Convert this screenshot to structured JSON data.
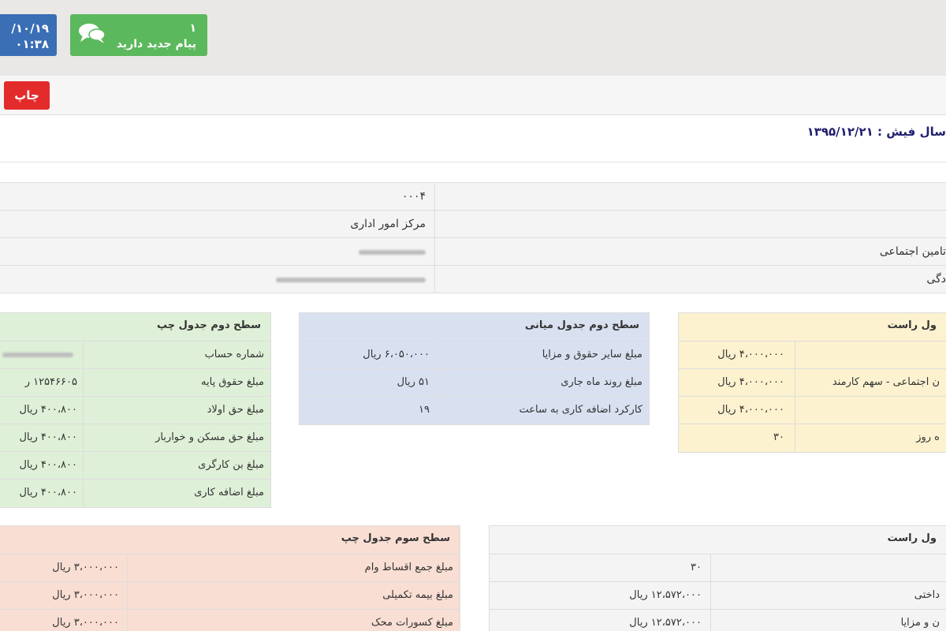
{
  "header": {
    "date": "/۱۰/۱۹",
    "time": "۰۱:۳۸",
    "messages": {
      "count": "۱",
      "text": "پیام جدید دارید",
      "icon": "chat-bubbles-icon"
    },
    "colors": {
      "date_box": "#3a6eb5",
      "message_box": "#5cb85c",
      "print_button": "#e32b2b"
    }
  },
  "toolbar": {
    "print_label": "چاپ"
  },
  "issue": {
    "label": "سال فیش :",
    "date": "۱۳۹۵/۱۲/۲۱"
  },
  "info": {
    "rows": [
      {
        "label": "",
        "value": "۰۰۰۴"
      },
      {
        "label": "",
        "value": "مرکز امور اداری"
      },
      {
        "label": "تامین اجتماعی",
        "value": ""
      },
      {
        "label": "دگی",
        "value": ""
      }
    ]
  },
  "panels": {
    "green": {
      "title": "سطح دوم جدول چپ",
      "rows": [
        {
          "label": "شماره حساب",
          "value": ""
        },
        {
          "label": "مبلغ حقوق پایه",
          "value": "۱۲۵۴۶۶۰۵ ر"
        },
        {
          "label": "مبلغ حق اولاد",
          "value": "۴۰۰،۸۰۰ ریال"
        },
        {
          "label": "مبلغ حق مسکن و خواربار",
          "value": "۴۰۰،۸۰۰ ریال"
        },
        {
          "label": "مبلغ بن کارگری",
          "value": "۴۰۰،۸۰۰ ریال"
        },
        {
          "label": "مبلغ اضافه کاری",
          "value": "۴۰۰،۸۰۰ ریال"
        }
      ]
    },
    "blue": {
      "title": "سطح دوم جدول میانی",
      "rows": [
        {
          "label": "مبلغ سایر حقوق و مزایا",
          "value": "۶،۰۵۰،۰۰۰ ریال"
        },
        {
          "label": "مبلغ روند ماه جاری",
          "value": "۵۱ ریال"
        },
        {
          "label": "کارکرد اضافه کاری به ساعت",
          "value": "۱۹"
        }
      ]
    },
    "yellow": {
      "title": "ول راست",
      "rows": [
        {
          "label": "",
          "value": "۴،۰۰۰،۰۰۰ ریال"
        },
        {
          "label": "ن اجتماعی - سهم کارمند",
          "value": "۴،۰۰۰،۰۰۰ ریال"
        },
        {
          "label": "",
          "value": "۴،۰۰۰،۰۰۰ ریال"
        },
        {
          "label": "ه روز",
          "value": "۳۰"
        }
      ]
    },
    "salmon": {
      "title": "سطح سوم جدول چپ",
      "rows": [
        {
          "label": "مبلغ جمع اقساط وام",
          "value": "۳،۰۰۰،۰۰۰ ریال"
        },
        {
          "label": "مبلغ بیمه تکمیلی",
          "value": "۳،۰۰۰،۰۰۰ ریال"
        },
        {
          "label": "مبلغ کسورات محک",
          "value": "۳،۰۰۰،۰۰۰ ریال"
        }
      ]
    },
    "gray": {
      "title": "ول راست",
      "rows": [
        {
          "label": "",
          "value": "۳۰"
        },
        {
          "label": "داختی",
          "value": "۱۲،۵۷۲،۰۰۰ ریال"
        },
        {
          "label": "ن و مزایا",
          "value": "۱۲،۵۷۲،۰۰۰ ریال"
        }
      ]
    }
  }
}
